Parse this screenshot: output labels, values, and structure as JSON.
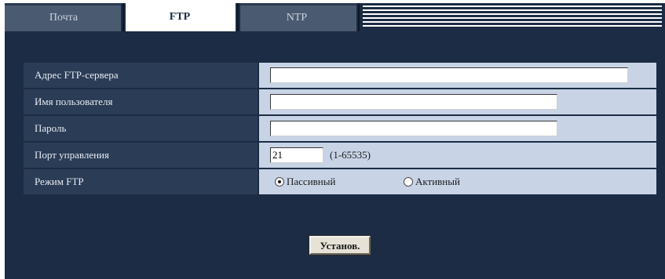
{
  "tabs": [
    {
      "label": "Почта",
      "active": false
    },
    {
      "label": "FTP",
      "active": true
    },
    {
      "label": "NTP",
      "active": false
    }
  ],
  "form": {
    "server_address": {
      "label": "Адрес FTP-сервера",
      "value": ""
    },
    "username": {
      "label": "Имя пользователя",
      "value": ""
    },
    "password": {
      "label": "Пароль",
      "value": ""
    },
    "control_port": {
      "label": "Порт управления",
      "value": "21",
      "range": "(1-65535)"
    },
    "ftp_mode": {
      "label": "Режим FTP",
      "options": [
        {
          "label": "Пассивный",
          "checked": true
        },
        {
          "label": "Активный",
          "checked": false
        }
      ]
    }
  },
  "set_button_label": "Установ.",
  "colors": {
    "panel_bg": "#1b2c44",
    "label_bg": "#2b3c56",
    "value_bg": "#c8d4e6"
  }
}
